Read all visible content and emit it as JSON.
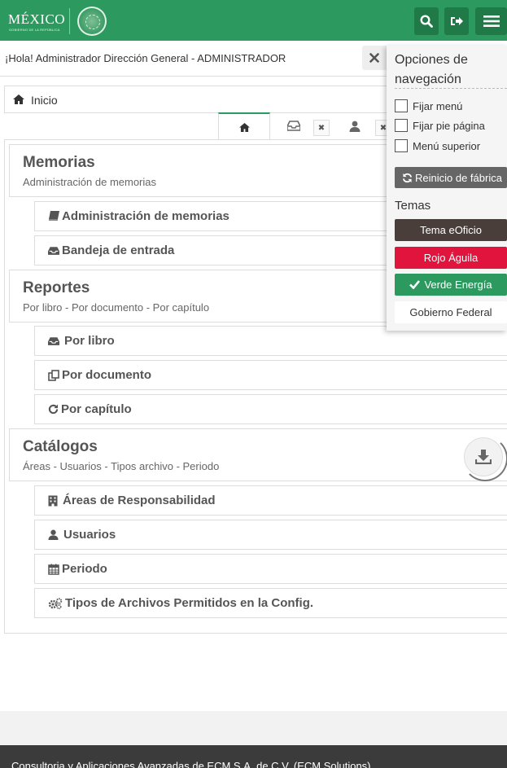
{
  "header": {
    "logo_text": "MÉXICO",
    "logo_subtext": "GOBIERNO DE LA REPÚBLICA"
  },
  "greeting": "¡Hola! Administrador Dirección General - ADMINISTRADOR",
  "breadcrumb": {
    "label": "Inicio"
  },
  "sections": [
    {
      "title": "Memorias",
      "subtitle": "Administración de memorias",
      "items": [
        {
          "label": "Administración de memorias",
          "icon": "book-icon"
        },
        {
          "label": "Bandeja de entrada",
          "icon": "inbox-icon"
        }
      ]
    },
    {
      "title": "Reportes",
      "subtitle": "Por libro - Por documento - Por capítulo",
      "items": [
        {
          "label": "Por libro",
          "icon": "inbox-icon"
        },
        {
          "label": "Por documento",
          "icon": "copy-icon"
        },
        {
          "label": "Por capítulo",
          "icon": "repeat-icon"
        }
      ]
    },
    {
      "title": "Catálogos",
      "subtitle": "Áreas - Usuarios - Tipos archivo - Periodo",
      "items": [
        {
          "label": "Áreas de Responsabilidad",
          "icon": "building-icon"
        },
        {
          "label": "Usuarios",
          "icon": "user-icon"
        },
        {
          "label": "Periodo",
          "icon": "calendar-icon"
        },
        {
          "label": "Tipos de Archivos Permitidos en la Config.",
          "icon": "gears-icon"
        }
      ]
    }
  ],
  "footer": {
    "text": "Consultoria y Aplicaciones Avanzadas de ECM S.A. de C.V. (ECM Solutions)"
  },
  "nav_options": {
    "title": "Opciones de navegación",
    "checkboxes": [
      {
        "label": "Fijar menú",
        "checked": false
      },
      {
        "label": "Fijar pie página",
        "checked": false
      },
      {
        "label": "Menú superior",
        "checked": false
      }
    ],
    "reset_label": "Reinicio de fábrica",
    "themes_label": "Temas",
    "themes": [
      {
        "label": "Tema eOficio",
        "bg": "#4a3e3a",
        "color": "#ffffff",
        "selected": false
      },
      {
        "label": "Rojo Águila",
        "bg": "#e0143c",
        "color": "#ffffff",
        "selected": false
      },
      {
        "label": "Verde Energía",
        "bg": "#2c9a5e",
        "color": "#ffffff",
        "selected": true
      },
      {
        "label": "Gobierno Federal",
        "bg": "#ffffff",
        "color": "#333333",
        "selected": false
      }
    ]
  },
  "colors": {
    "brand_green": "#2c9a5e",
    "brand_green_dark": "#1f7a47",
    "footer_dark": "#3b3b3b"
  }
}
